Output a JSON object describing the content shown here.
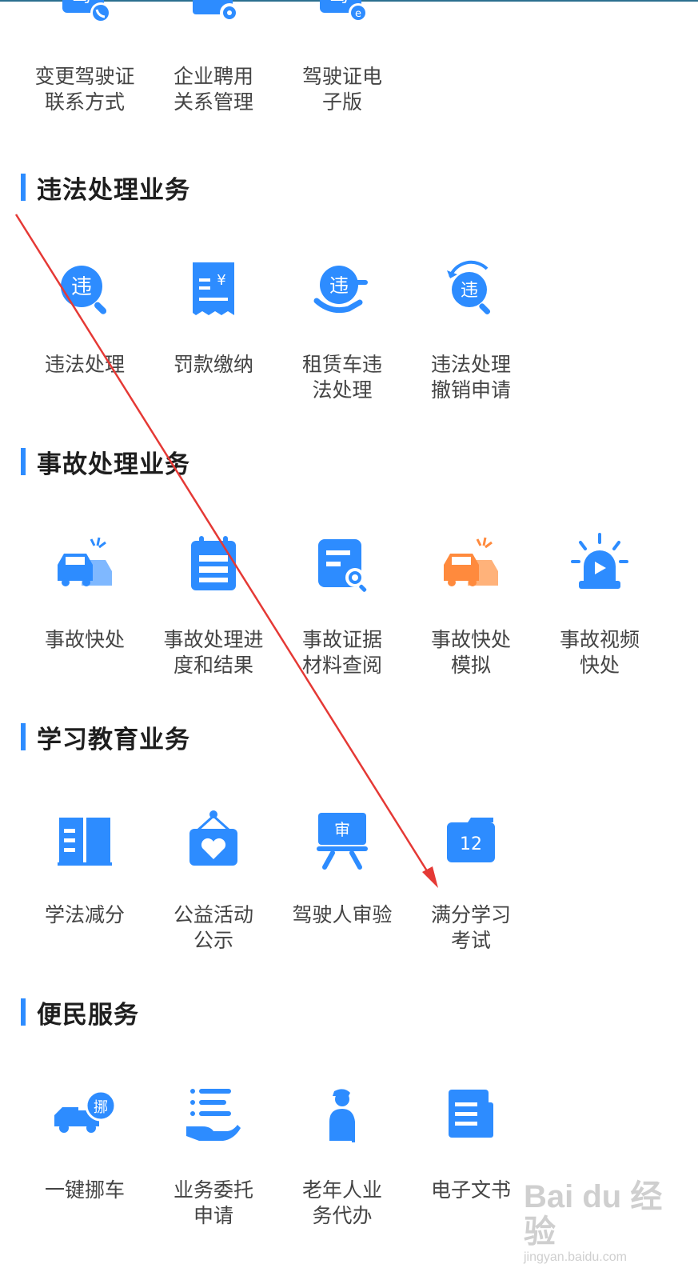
{
  "top_row": {
    "items": [
      {
        "label": "变更驾驶证\n联系方式",
        "icon": "license-phone-icon",
        "glyph": "驾"
      },
      {
        "label": "企业聘用\n关系管理",
        "icon": "hire-gear-icon",
        "glyph": "聘"
      },
      {
        "label": "驾驶证电\n子版",
        "icon": "license-electronic-icon",
        "glyph": "驾"
      }
    ]
  },
  "sections": [
    {
      "title": "违法处理业务",
      "items": [
        {
          "label": "违法处理",
          "icon": "violation-search-icon",
          "glyph": "违"
        },
        {
          "label": "罚款缴纳",
          "icon": "fine-receipt-icon",
          "glyph": "¥"
        },
        {
          "label": "租赁车违\n法处理",
          "icon": "rental-violation-icon",
          "glyph": "违"
        },
        {
          "label": "违法处理\n撤销申请",
          "icon": "violation-revoke-icon",
          "glyph": "违"
        }
      ]
    },
    {
      "title": "事故处理业务",
      "items": [
        {
          "label": "事故快处",
          "icon": "car-crash-icon"
        },
        {
          "label": "事故处理进\n度和结果",
          "icon": "progress-clipboard-icon"
        },
        {
          "label": "事故证据\n材料查阅",
          "icon": "document-search-icon"
        },
        {
          "label": "事故快处\n模拟",
          "icon": "car-crash-orange-icon"
        },
        {
          "label": "事故视频\n快处",
          "icon": "video-siren-icon"
        }
      ]
    },
    {
      "title": "学习教育业务",
      "items": [
        {
          "label": "学法减分",
          "icon": "open-book-icon"
        },
        {
          "label": "公益活动\n公示",
          "icon": "heart-sign-icon"
        },
        {
          "label": "驾驶人审验",
          "icon": "review-board-icon",
          "glyph": "审"
        },
        {
          "label": "满分学习\n考试",
          "icon": "calendar-12-icon",
          "glyph": "12"
        }
      ]
    },
    {
      "title": "便民服务",
      "items": [
        {
          "label": "一键挪车",
          "icon": "move-car-truck-icon",
          "glyph": "挪"
        },
        {
          "label": "业务委托\n申请",
          "icon": "hand-list-icon"
        },
        {
          "label": "老年人业\n务代办",
          "icon": "elderly-person-icon"
        },
        {
          "label": "电子文书",
          "icon": "e-document-icon"
        }
      ]
    }
  ],
  "watermark": {
    "line1": "Bai du 经验",
    "line2": "jingyan.baidu.com"
  },
  "colors": {
    "primary": "#2d8cff",
    "orange": "#ff8a3d",
    "accent_bar": "#2d8cff",
    "arrow": "#e53935"
  }
}
